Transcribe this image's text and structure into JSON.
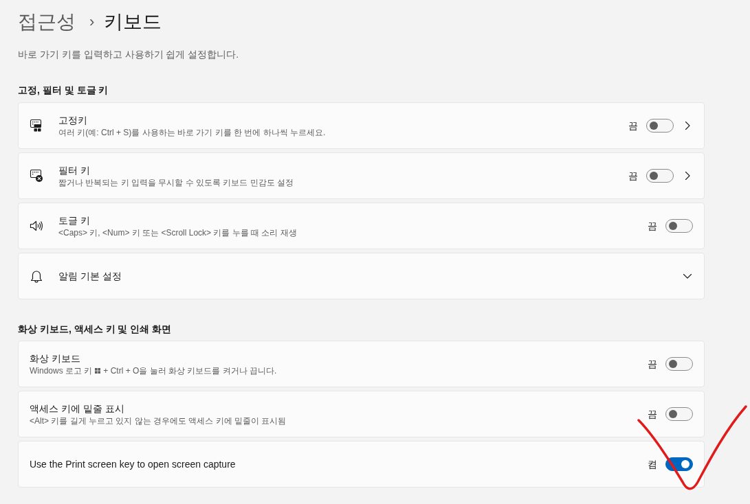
{
  "breadcrumb": {
    "parent": "접근성",
    "separator": "›",
    "current": "키보드"
  },
  "intro": "바로 가기 키를 입력하고 사용하기 쉽게 설정합니다.",
  "sections": [
    {
      "heading": "고정, 필터 및 토글 키",
      "rows": [
        {
          "kind": "toggle_link",
          "title": "고정키",
          "description": "여러 키(예: Ctrl + S)를 사용하는 바로 가기 키를 한 번에 하나씩 누르세요.",
          "state_label": "끔",
          "on": false
        },
        {
          "kind": "toggle_link",
          "title": "필터 키",
          "description": "짧거나 반복되는 키 입력을 무시할 수 있도록 키보드 민감도 설정",
          "state_label": "끔",
          "on": false
        },
        {
          "kind": "toggle",
          "title": "토글 키",
          "description": "<Caps> 키, <Num> 키 또는 <Scroll Lock> 키를 누를 때 소리 재생",
          "state_label": "끔",
          "on": false
        },
        {
          "kind": "expander",
          "title": "알림 기본 설정",
          "expanded": false
        }
      ]
    },
    {
      "heading": "화상 키보드, 액세스 키 및 인쇄 화면",
      "rows": [
        {
          "kind": "toggle",
          "title": "화상 키보드",
          "description": "Windows 로고 키",
          "description_continued": "+ Ctrl + O을 눌러 화상 키보드를 켜거나 끕니다.",
          "state_label": "끔",
          "on": false
        },
        {
          "kind": "toggle",
          "title": "액세스 키에 밑줄 표시",
          "description": "<Alt> 키를 길게 누르고 있지 않는 경우에도 액세스 키에 밑줄이 표시됨",
          "state_label": "끔",
          "on": false
        },
        {
          "kind": "toggle",
          "title": "Use the Print screen key to open screen capture",
          "state_label": "켬",
          "on": true
        }
      ]
    }
  ],
  "annotation": {
    "kind": "checkmark"
  }
}
